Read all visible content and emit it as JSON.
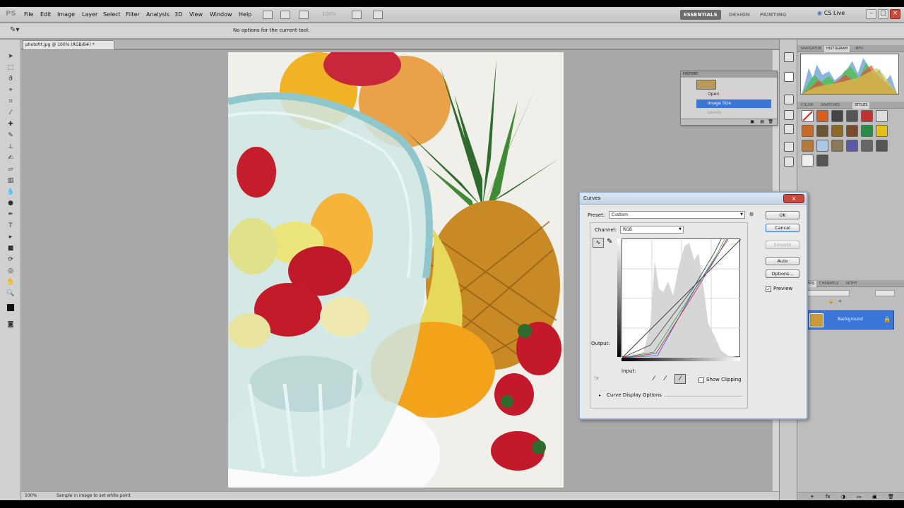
{
  "app": {
    "logo": "PS",
    "colors": {
      "selection": "#3a76d8",
      "close_red": "#c9483a"
    }
  },
  "menu": [
    "File",
    "Edit",
    "Image",
    "Layer",
    "Select",
    "Filter",
    "Analysis",
    "3D",
    "View",
    "Window",
    "Help"
  ],
  "zoom_box": "100%",
  "workspaces": [
    "ESSENTIALS",
    "DESIGN",
    "PAINTING"
  ],
  "cslive": "CS Live",
  "options_bar": {
    "message": "No options for the current tool."
  },
  "document": {
    "tab": "photofrt.jpg @ 100% (RGB/8#) *"
  },
  "status": {
    "zoom": "100%",
    "hint": "Sample in image to set white point"
  },
  "history": {
    "title": "HISTORY",
    "items": [
      "Open",
      "Image Size",
      "Levels"
    ],
    "selected_index": 1
  },
  "panels": {
    "top_tabs": [
      "NAVIGATOR",
      "HISTOGRAM",
      "INFO"
    ],
    "mid_tabs": [
      "COLOR",
      "SWATCHES",
      "STYLES"
    ],
    "layer_tabs": [
      "LAYERS",
      "CHANNELS",
      "PATHS"
    ],
    "layer_name": "Background"
  },
  "curves": {
    "title": "Curves",
    "preset_label": "Preset:",
    "preset_value": "Custom",
    "channel_label": "Channel:",
    "channel_value": "RGB",
    "output_label": "Output:",
    "input_label": "Input:",
    "buttons": {
      "ok": "OK",
      "cancel": "Cancel",
      "smooth": "Smooth",
      "auto": "Auto",
      "options": "Options..."
    },
    "preview_label": "Preview",
    "preview_checked": true,
    "show_clipping_label": "Show Clipping",
    "display_options": "Curve Display Options"
  }
}
